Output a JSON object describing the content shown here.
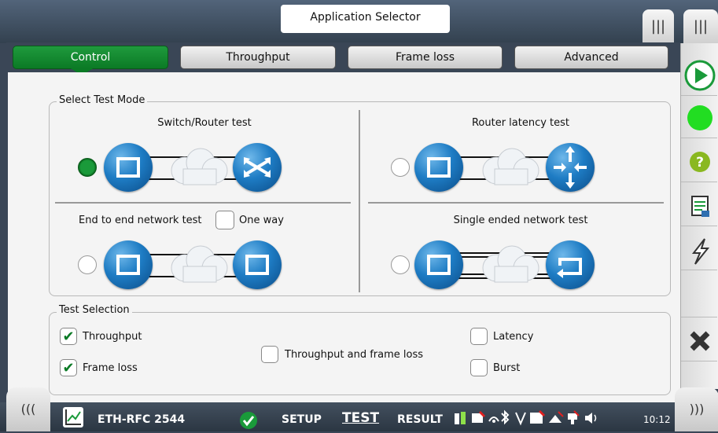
{
  "header": {
    "title": "Application Selector",
    "menu_icon": "|||"
  },
  "tabs": [
    {
      "label": "Control",
      "active": true
    },
    {
      "label": "Throughput",
      "active": false
    },
    {
      "label": "Frame loss",
      "active": false
    },
    {
      "label": "Advanced",
      "active": false
    }
  ],
  "test_mode": {
    "legend": "Select Test Mode",
    "switch_router": {
      "title": "Switch/Router test",
      "selected": true
    },
    "router_latency": {
      "title": "Router latency test",
      "selected": false
    },
    "end_to_end": {
      "title": "End to end network test",
      "one_way_label": "One way",
      "one_way_checked": false,
      "selected": false
    },
    "single_ended": {
      "title": "Single ended network test",
      "selected": false
    }
  },
  "test_selection": {
    "legend": "Test Selection",
    "items": [
      {
        "label": "Throughput",
        "checked": true
      },
      {
        "label": "Frame loss",
        "checked": true
      },
      {
        "label": "Throughput and frame loss",
        "checked": false
      },
      {
        "label": "Latency",
        "checked": false
      },
      {
        "label": "Burst",
        "checked": false
      }
    ]
  },
  "sidebar": [
    "play-icon",
    "status-led-icon",
    "help-icon",
    "report-icon",
    "lightning-icon",
    "close-icon"
  ],
  "bottom": {
    "app_name": "ETH-RFC 2544",
    "setup": "SETUP",
    "test": "TEST",
    "result": "RESULT",
    "time": "10:12",
    "left_nav": "(((",
    "right_nav": ")))"
  },
  "colors": {
    "accent_green": "#0b7a25",
    "orb_blue": "#1e7cc4",
    "help_green": "#8ab820"
  }
}
